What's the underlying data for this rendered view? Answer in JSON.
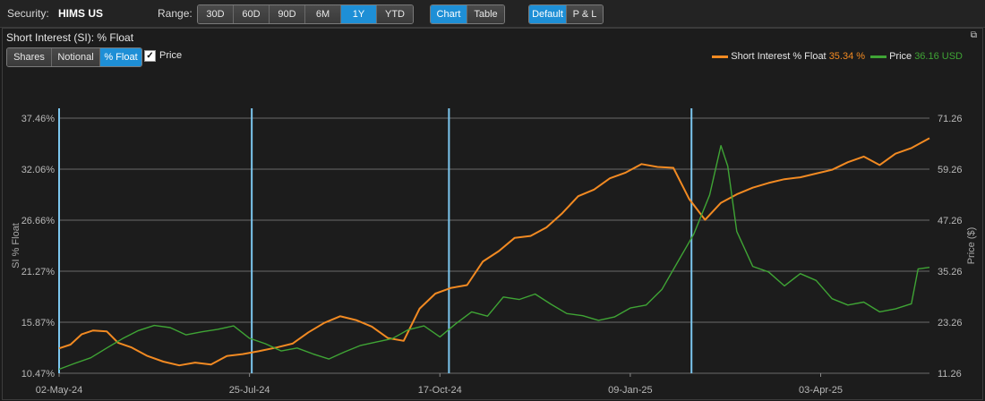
{
  "toolbar": {
    "security_label": "Security:",
    "security_value": "HIMS US",
    "range_label": "Range:",
    "range_buttons": [
      "30D",
      "60D",
      "90D",
      "6M",
      "1Y",
      "YTD"
    ],
    "range_active": "1Y",
    "view_buttons": [
      "Chart",
      "Table"
    ],
    "view_active": "Chart",
    "mode_buttons": [
      "Default",
      "P & L"
    ],
    "mode_active": "Default"
  },
  "panel": {
    "title": "Short Interest (SI): % Float",
    "unit_buttons": [
      "Shares",
      "Notional",
      "% Float"
    ],
    "unit_active": "% Float",
    "price_checkbox_label": "Price",
    "price_checked": true,
    "restore_glyph": "⧉"
  },
  "legend": {
    "si_name": "Short Interest % Float",
    "si_value": "35.34 %",
    "price_name": "Price",
    "price_value": "36.16 USD"
  },
  "colors": {
    "si": "#f28a22",
    "price": "#3fa435",
    "marker": "#7cc6ee",
    "grid": "#6a6a6a"
  },
  "chart_data": {
    "type": "line",
    "xlabel": "",
    "ylabel_left": "SI % Float",
    "ylabel_right": "Price ($)",
    "x_tick_labels": [
      "02-May-24",
      "25-Jul-24",
      "17-Oct-24",
      "09-Jan-25",
      "03-Apr-25"
    ],
    "x_ticks": [
      "2024-05-02",
      "2024-07-25",
      "2024-10-17",
      "2025-01-09",
      "2025-04-03"
    ],
    "x_range": [
      "2024-05-02",
      "2025-05-21"
    ],
    "y_left_ticks": [
      "10.47%",
      "15.87%",
      "21.27%",
      "26.66%",
      "32.06%",
      "37.46%"
    ],
    "y_left_range": [
      10.47,
      37.46
    ],
    "y_right_ticks": [
      "11.26",
      "23.26",
      "35.26",
      "47.26",
      "59.26",
      "71.26"
    ],
    "y_right_range": [
      11.26,
      71.26
    ],
    "grid": true,
    "legend_position": "top-right",
    "vertical_markers": [
      "2024-05-02",
      "2024-07-26",
      "2024-10-21",
      "2025-02-05"
    ],
    "series": [
      {
        "name": "Short Interest % Float",
        "axis": "left",
        "points": [
          [
            "2024-05-02",
            13.1
          ],
          [
            "2024-05-07",
            13.5
          ],
          [
            "2024-05-12",
            14.6
          ],
          [
            "2024-05-17",
            15.0
          ],
          [
            "2024-05-23",
            14.9
          ],
          [
            "2024-05-28",
            13.7
          ],
          [
            "2024-06-03",
            13.2
          ],
          [
            "2024-06-10",
            12.3
          ],
          [
            "2024-06-17",
            11.7
          ],
          [
            "2024-06-24",
            11.3
          ],
          [
            "2024-07-01",
            11.6
          ],
          [
            "2024-07-08",
            11.4
          ],
          [
            "2024-07-15",
            12.3
          ],
          [
            "2024-07-22",
            12.5
          ],
          [
            "2024-07-29",
            12.8
          ],
          [
            "2024-08-06",
            13.2
          ],
          [
            "2024-08-13",
            13.6
          ],
          [
            "2024-08-20",
            14.8
          ],
          [
            "2024-08-27",
            15.8
          ],
          [
            "2024-09-03",
            16.5
          ],
          [
            "2024-09-10",
            16.1
          ],
          [
            "2024-09-17",
            15.4
          ],
          [
            "2024-09-24",
            14.2
          ],
          [
            "2024-10-01",
            13.9
          ],
          [
            "2024-10-08",
            17.3
          ],
          [
            "2024-10-15",
            18.9
          ],
          [
            "2024-10-22",
            19.5
          ],
          [
            "2024-10-29",
            19.8
          ],
          [
            "2024-11-05",
            22.3
          ],
          [
            "2024-11-12",
            23.4
          ],
          [
            "2024-11-19",
            24.8
          ],
          [
            "2024-11-26",
            25.0
          ],
          [
            "2024-12-03",
            25.9
          ],
          [
            "2024-12-10",
            27.4
          ],
          [
            "2024-12-17",
            29.2
          ],
          [
            "2024-12-24",
            29.9
          ],
          [
            "2024-12-31",
            31.1
          ],
          [
            "2025-01-07",
            31.7
          ],
          [
            "2025-01-14",
            32.6
          ],
          [
            "2025-01-21",
            32.3
          ],
          [
            "2025-01-28",
            32.2
          ],
          [
            "2025-02-04",
            28.9
          ],
          [
            "2025-02-11",
            26.7
          ],
          [
            "2025-02-18",
            28.5
          ],
          [
            "2025-02-25",
            29.4
          ],
          [
            "2025-03-04",
            30.1
          ],
          [
            "2025-03-11",
            30.6
          ],
          [
            "2025-03-18",
            31.0
          ],
          [
            "2025-03-25",
            31.2
          ],
          [
            "2025-04-01",
            31.6
          ],
          [
            "2025-04-08",
            32.0
          ],
          [
            "2025-04-15",
            32.8
          ],
          [
            "2025-04-22",
            33.4
          ],
          [
            "2025-04-29",
            32.5
          ],
          [
            "2025-05-06",
            33.7
          ],
          [
            "2025-05-13",
            34.3
          ],
          [
            "2025-05-21",
            35.34
          ]
        ]
      },
      {
        "name": "Price",
        "axis": "right",
        "points": [
          [
            "2024-05-02",
            12.2
          ],
          [
            "2024-05-09",
            13.6
          ],
          [
            "2024-05-16",
            14.9
          ],
          [
            "2024-05-23",
            17.2
          ],
          [
            "2024-05-30",
            19.4
          ],
          [
            "2024-06-06",
            21.3
          ],
          [
            "2024-06-13",
            22.5
          ],
          [
            "2024-06-20",
            22.0
          ],
          [
            "2024-06-27",
            20.3
          ],
          [
            "2024-07-04",
            21.0
          ],
          [
            "2024-07-11",
            21.6
          ],
          [
            "2024-07-18",
            22.4
          ],
          [
            "2024-07-25",
            19.5
          ],
          [
            "2024-08-01",
            18.2
          ],
          [
            "2024-08-08",
            16.5
          ],
          [
            "2024-08-15",
            17.2
          ],
          [
            "2024-08-22",
            15.8
          ],
          [
            "2024-08-29",
            14.6
          ],
          [
            "2024-09-05",
            16.3
          ],
          [
            "2024-09-12",
            17.8
          ],
          [
            "2024-09-19",
            18.6
          ],
          [
            "2024-09-26",
            19.4
          ],
          [
            "2024-10-03",
            21.5
          ],
          [
            "2024-10-10",
            22.4
          ],
          [
            "2024-10-17",
            19.8
          ],
          [
            "2024-10-24",
            22.9
          ],
          [
            "2024-10-31",
            25.7
          ],
          [
            "2024-11-07",
            24.7
          ],
          [
            "2024-11-14",
            29.2
          ],
          [
            "2024-11-21",
            28.6
          ],
          [
            "2024-11-28",
            29.9
          ],
          [
            "2024-12-05",
            27.5
          ],
          [
            "2024-12-12",
            25.3
          ],
          [
            "2024-12-19",
            24.8
          ],
          [
            "2024-12-26",
            23.7
          ],
          [
            "2025-01-02",
            24.5
          ],
          [
            "2025-01-09",
            26.6
          ],
          [
            "2025-01-16",
            27.3
          ],
          [
            "2025-01-23",
            31.0
          ],
          [
            "2025-01-30",
            37.5
          ],
          [
            "2025-02-06",
            44.0
          ],
          [
            "2025-02-13",
            53.2
          ],
          [
            "2025-02-18",
            64.8
          ],
          [
            "2025-02-21",
            60.0
          ],
          [
            "2025-02-25",
            44.6
          ],
          [
            "2025-03-04",
            36.4
          ],
          [
            "2025-03-11",
            35.1
          ],
          [
            "2025-03-18",
            31.8
          ],
          [
            "2025-03-25",
            34.7
          ],
          [
            "2025-04-01",
            33.1
          ],
          [
            "2025-04-08",
            28.8
          ],
          [
            "2025-04-15",
            27.3
          ],
          [
            "2025-04-22",
            28.0
          ],
          [
            "2025-04-29",
            25.7
          ],
          [
            "2025-05-06",
            26.4
          ],
          [
            "2025-05-13",
            27.6
          ],
          [
            "2025-05-16",
            35.8
          ],
          [
            "2025-05-21",
            36.16
          ]
        ]
      }
    ]
  }
}
